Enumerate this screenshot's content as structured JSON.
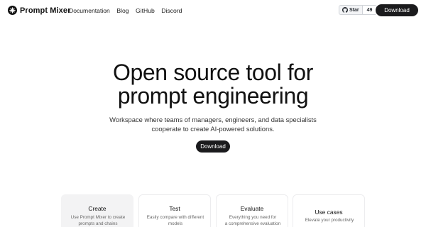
{
  "header": {
    "brand": "Prompt Mixer",
    "nav": [
      "Documentation",
      "Blog",
      "GitHub",
      "Discord"
    ],
    "star_label": "Star",
    "star_count": "49",
    "download_label": "Download"
  },
  "hero": {
    "title_line1": "Open source tool for",
    "title_line2": "prompt engineering",
    "subtitle_line1": "Workspace where teams of managers, engineers, and data specialists",
    "subtitle_line2": "cooperate to create AI-powered solutions.",
    "download_label": "Download"
  },
  "features": [
    {
      "title": "Create",
      "desc_line1": "Use Prompt Mixer to create",
      "desc_line2": "prompts and chains"
    },
    {
      "title": "Test",
      "desc_line1": "Easily compare with different",
      "desc_line2": "models"
    },
    {
      "title": "Evaluate",
      "desc_line1": "Everything you need for",
      "desc_line2": "a comprehensive evaluation"
    },
    {
      "title": "Use cases",
      "desc_line1": "Elevate your productivity",
      "desc_line2": ""
    }
  ],
  "colors": {
    "primary_button": "#1b1b1d",
    "active_card": "#f3f3f4"
  },
  "icons": {
    "logo": "spark-icon",
    "github": "github-icon"
  }
}
